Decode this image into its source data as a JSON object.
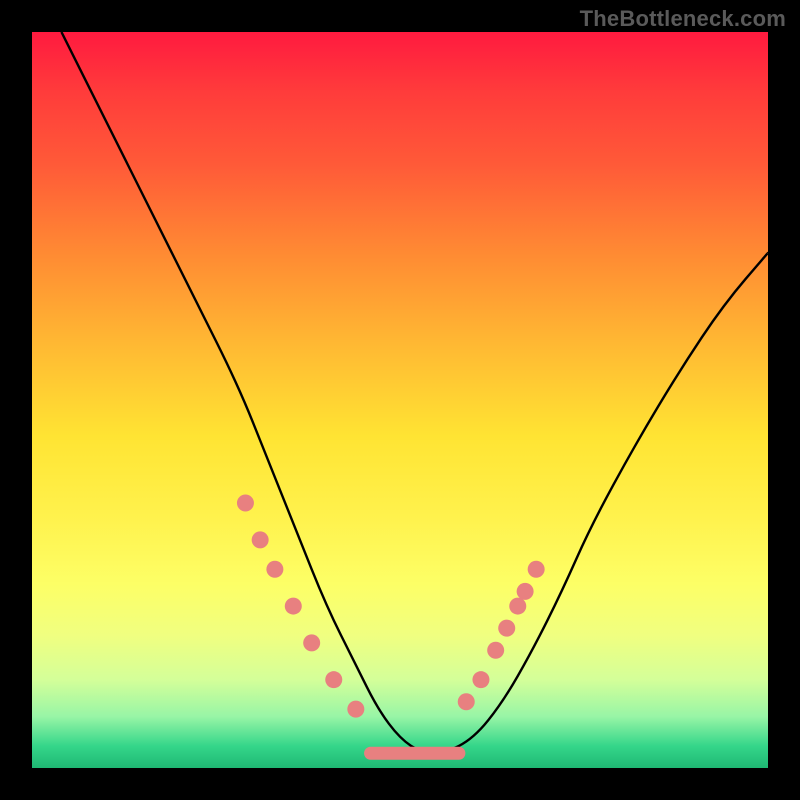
{
  "attribution": "TheBottleneck.com",
  "chart_data": {
    "type": "line",
    "title": "",
    "xlabel": "",
    "ylabel": "",
    "xlim": [
      0,
      100
    ],
    "ylim": [
      0,
      100
    ],
    "series": [
      {
        "name": "bottleneck-curve",
        "x": [
          4,
          10,
          16,
          22,
          28,
          32,
          36,
          40,
          44,
          47,
          50,
          53,
          56,
          60,
          64,
          68,
          72,
          76,
          82,
          88,
          94,
          100
        ],
        "y": [
          100,
          88,
          76,
          64,
          52,
          42,
          32,
          22,
          14,
          8,
          4,
          2,
          2,
          4,
          9,
          16,
          24,
          33,
          44,
          54,
          63,
          70
        ]
      }
    ],
    "markers": {
      "name": "highlighted-points",
      "x": [
        29,
        31,
        33,
        35.5,
        38,
        41,
        44,
        59,
        61,
        63,
        64.5,
        66,
        67,
        68.5
      ],
      "y": [
        36,
        31,
        27,
        22,
        17,
        12,
        8,
        9,
        12,
        16,
        19,
        22,
        24,
        27
      ]
    },
    "flat_segment": {
      "x0": 46,
      "x1": 58,
      "y": 2
    },
    "grid": false,
    "legend": false
  }
}
